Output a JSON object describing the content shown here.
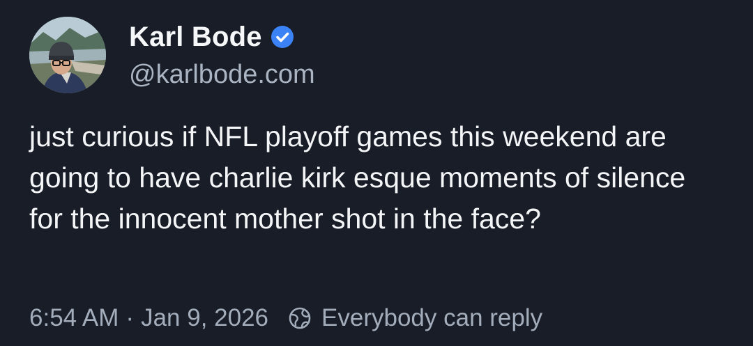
{
  "post": {
    "author": {
      "display_name": "Karl Bode",
      "handle": "@karlbode.com",
      "verified": true
    },
    "text": "just curious if NFL playoff games this weekend are going to have charlie kirk esque moments of silence for the innocent mother shot in the face?",
    "time": "6:54 AM",
    "separator": "·",
    "date": "Jan 9, 2026",
    "reply_setting": "Everybody can reply",
    "icons": {
      "verified": "verified-badge-icon",
      "reply_setting": "globe-icon"
    }
  },
  "colors": {
    "background": "#181d27",
    "text": "#f4f5f7",
    "muted": "#a3adbb",
    "verified": "#3b82f6"
  }
}
